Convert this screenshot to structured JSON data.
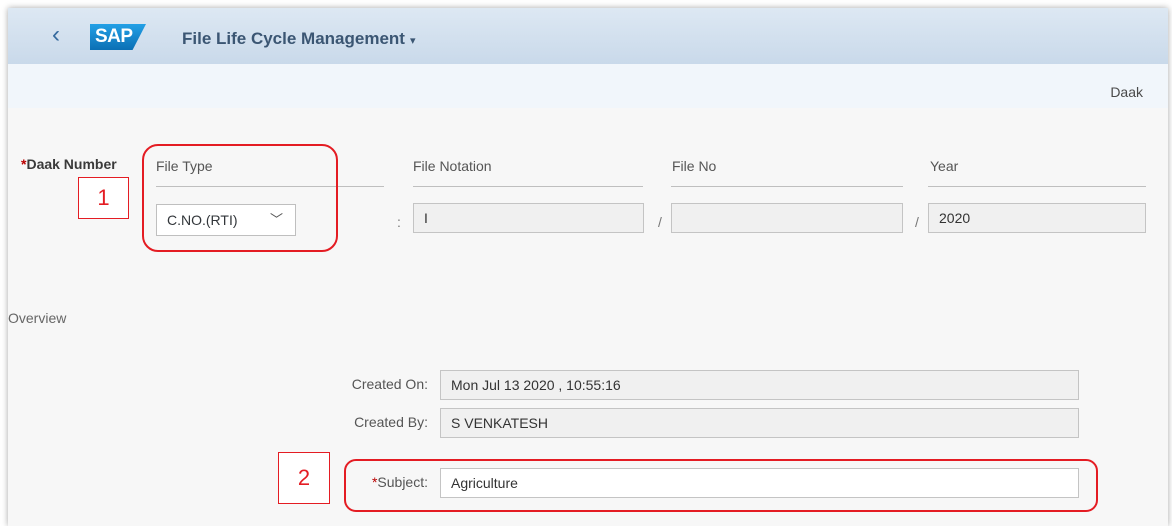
{
  "header": {
    "back_icon": "chevron-left-icon",
    "logo_text": "SAP",
    "app_title": "File Life Cycle Management",
    "title_caret": "▾"
  },
  "subheader": {
    "page_tab": "Daak"
  },
  "daak": {
    "label": "Daak Number",
    "required_mark": "*",
    "file_type": {
      "label": "File Type",
      "value": "C.NO.(RTI)",
      "chevron": "﹀"
    },
    "file_notation": {
      "label": "File Notation",
      "value": "I"
    },
    "file_no": {
      "label": "File No",
      "value": ""
    },
    "year": {
      "label": "Year",
      "value": "2020"
    },
    "separators": {
      "colon": ":",
      "slash1": "/",
      "slash2": "/"
    }
  },
  "overview": {
    "title": "Overview",
    "created_on": {
      "label": "Created On:",
      "value": "Mon Jul 13 2020 , 10:55:16"
    },
    "created_by": {
      "label": "Created By:",
      "value": "S VENKATESH"
    },
    "subject": {
      "required_mark": "*",
      "label": "Subject:",
      "value": "Agriculture"
    }
  },
  "annotations": {
    "one": "1",
    "two": "2"
  },
  "colors": {
    "annotation_red": "#e41c23",
    "header_blue": "#c9d9ea",
    "required_red": "#bb0000"
  }
}
